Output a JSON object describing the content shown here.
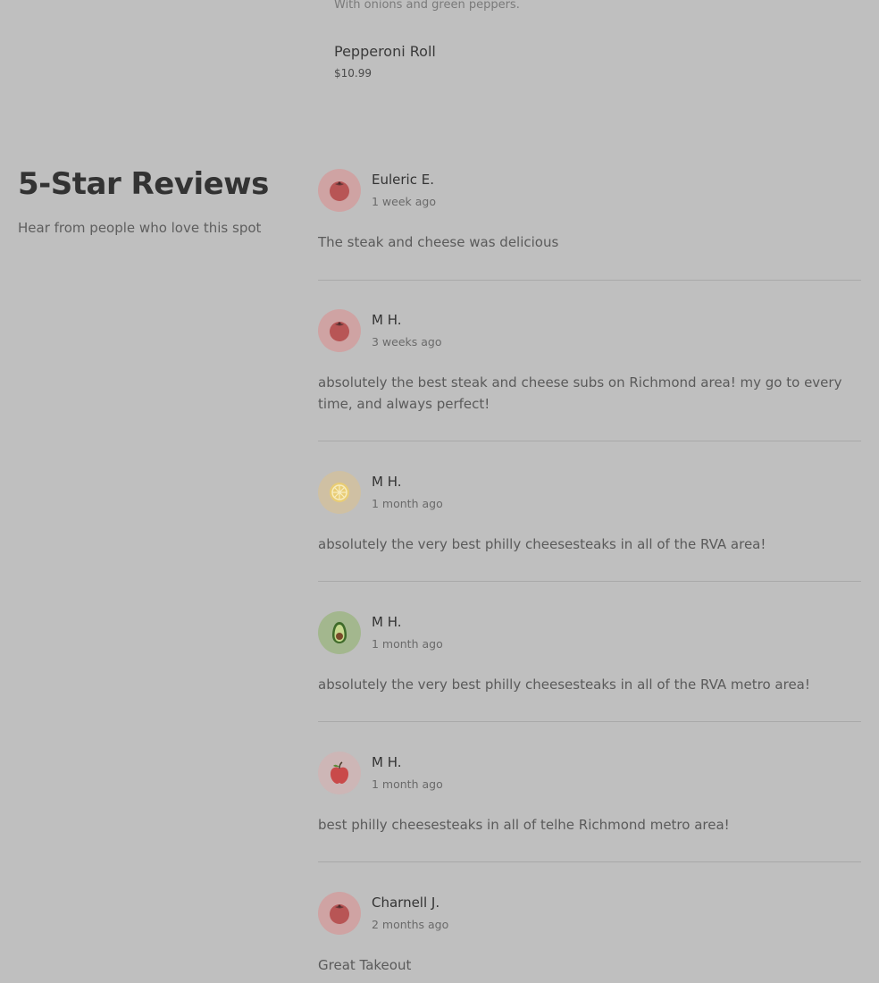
{
  "menu": {
    "prev_item_description": "With onions and green peppers.",
    "items": [
      {
        "name": "Pepperoni Roll",
        "price": "$10.99"
      }
    ]
  },
  "reviews_section": {
    "title": "5-Star Reviews",
    "subtitle": "Hear from people who love this spot"
  },
  "reviews": [
    {
      "author": "Euleric E.",
      "time": "1 week ago",
      "text": "The steak and cheese was delicious",
      "avatar_icon": "tomato-icon",
      "avatar_bg": "#cfa3a3"
    },
    {
      "author": "M H.",
      "time": "3 weeks ago",
      "text": "absolutely the best steak and cheese subs on Richmond area! my go to every time, and always perfect!",
      "avatar_icon": "tomato-icon",
      "avatar_bg": "#cfa3a3"
    },
    {
      "author": "M H.",
      "time": "1 month ago",
      "text": "absolutely the very best philly cheesesteaks in all of the RVA area!",
      "avatar_icon": "lemon-icon",
      "avatar_bg": "#cfc0a3"
    },
    {
      "author": "M H.",
      "time": "1 month ago",
      "text": "absolutely the very best philly cheesesteaks in all of the RVA metro area!",
      "avatar_icon": "avocado-icon",
      "avatar_bg": "#a3b78e"
    },
    {
      "author": "M H.",
      "time": "1 month ago",
      "text": "best philly cheesesteaks in all of telhe Richmond metro area!",
      "avatar_icon": "apple-icon",
      "avatar_bg": "#cdb6b6"
    },
    {
      "author": "Charnell J.",
      "time": "2 months ago",
      "text": "Great Takeout",
      "avatar_icon": "tomato-icon",
      "avatar_bg": "#cfa3a3"
    }
  ]
}
